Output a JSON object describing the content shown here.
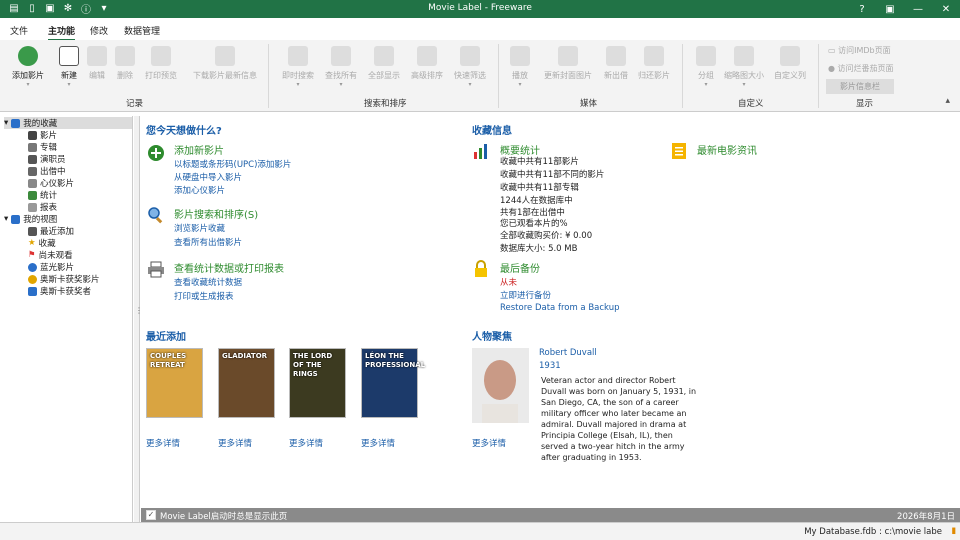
{
  "window": {
    "title": "Movie Label - Freeware",
    "help": "?",
    "restore": "▣",
    "minimize": "—",
    "close": "✕"
  },
  "tabs": [
    "文件",
    "主功能",
    "修改",
    "数据管理"
  ],
  "ribbon": {
    "buttons": [
      "添加影片",
      "新建",
      "编辑",
      "删除",
      "打印预览",
      "下载影片最新信息",
      "即时搜索",
      "查找所有",
      "全部显示",
      "高级排序",
      "快速筛选",
      "播放",
      "更新封面图片",
      "新出借",
      "归还影片",
      "分组",
      "缩略图大小",
      "自定义列"
    ],
    "groups": [
      "记录",
      "搜索和排序",
      "媒体",
      "自定义",
      "显示"
    ],
    "display": [
      "访问IMDb页面",
      "访问烂番茄页面",
      "影片信息栏"
    ]
  },
  "nav": {
    "root1": "我的收藏",
    "items1": [
      "影片",
      "专辑",
      "演职员",
      "出借中",
      "心仪影片",
      "统计",
      "报表"
    ],
    "root2": "我的视图",
    "items2": [
      "最近添加",
      "收藏",
      "尚未观看",
      "蓝光影片",
      "奥斯卡获奖影片",
      "奥斯卡获奖者"
    ]
  },
  "welcome": {
    "question": "您今天想做什么?",
    "add": {
      "title": "添加新影片",
      "links": [
        "以标题或条形码(UPC)添加影片",
        "从硬盘中导入影片",
        "添加心仪影片"
      ]
    },
    "search": {
      "title": "影片搜索和排序(S)",
      "links": [
        "浏览影片收藏",
        "查看所有出借影片"
      ]
    },
    "stats": {
      "title": "查看统计数据或打印报表",
      "links": [
        "查看收藏统计数据",
        "打印或生成报表"
      ]
    }
  },
  "collection": {
    "heading": "收藏信息",
    "summary_title": "概要统计",
    "lines": [
      "收藏中共有11部影片",
      "收藏中共有11部不同的影片",
      "收藏中共有11部专辑",
      "1244人在数据库中",
      "共有1部在出借中",
      "您已观看本片的%",
      "全部收藏购买价: ¥ 0.00",
      "数据库大小: 5.0 MB"
    ],
    "news": "最新电影资讯",
    "backup_title": "最后备份",
    "backup_status": "从未",
    "backup_links": [
      "立即进行备份",
      "Restore Data from a Backup"
    ]
  },
  "recent": {
    "heading": "最近添加",
    "more": "更多详情",
    "posters": [
      {
        "caption": "COUPLES RETREAT",
        "bg": "#d9a441"
      },
      {
        "caption": "GLADIATOR",
        "bg": "#6a4a2a"
      },
      {
        "caption": "THE LORD OF THE RINGS",
        "bg": "#3c3a20"
      },
      {
        "caption": "LÉON THE PROFESSIONAL",
        "bg": "#1c3a6a"
      }
    ]
  },
  "person": {
    "heading": "人物聚焦",
    "name": "Robert Duvall",
    "year": "1931",
    "bio": "Veteran actor and director Robert Duvall was born on January 5, 1931, in San Diego, CA, the son of a career military officer who later became an admiral. Duvall majored in drama at Principia College (Elsah, IL), then served a two-year hitch in the army after graduating in 1953.",
    "more": "更多详情"
  },
  "strip": {
    "checkbox": "Movie Label启动时总是显示此页",
    "date": "2026年8月1日"
  },
  "statusbar": {
    "db": "My Database.fdb : c:\\movie labe"
  },
  "colors": {
    "accent": "#217346",
    "link": "#1b5ea8",
    "green": "#2e8b2e"
  }
}
